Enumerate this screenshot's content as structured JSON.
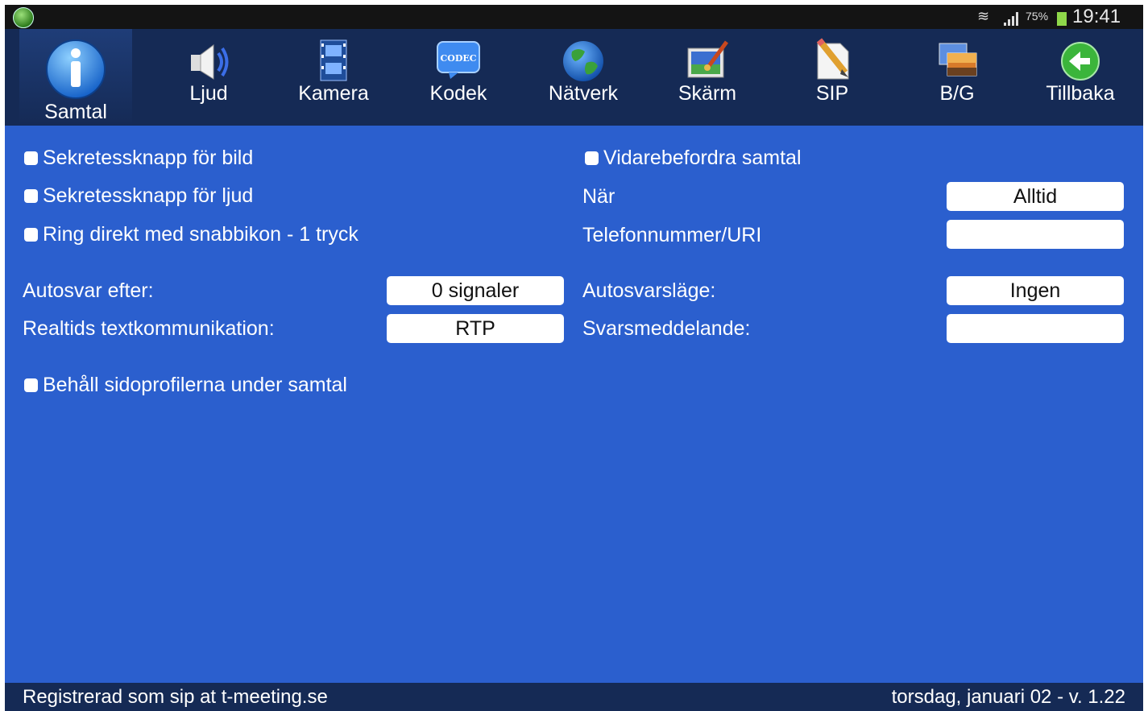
{
  "status": {
    "battery": "75%",
    "time": "19:41"
  },
  "toolbar": [
    {
      "label": "Samtal",
      "icon": "info-icon"
    },
    {
      "label": "Ljud",
      "icon": "speaker-icon"
    },
    {
      "label": "Kamera",
      "icon": "film-icon"
    },
    {
      "label": "Kodek",
      "icon": "codec-icon",
      "icon_text": "CODEC"
    },
    {
      "label": "Nätverk",
      "icon": "globe-icon"
    },
    {
      "label": "Skärm",
      "icon": "screen-brush-icon"
    },
    {
      "label": "SIP",
      "icon": "pencil-document-icon"
    },
    {
      "label": "B/G",
      "icon": "background-picture-icon"
    },
    {
      "label": "Tillbaka",
      "icon": "back-arrow-icon"
    }
  ],
  "left": {
    "cb_bild": "Sekretessknapp för bild",
    "cb_ljud": "Sekretessknapp för ljud",
    "cb_ring": "Ring direkt med snabbikon - 1 tryck",
    "autosvar_label": "Autosvar efter:",
    "autosvar_value": "0 signaler",
    "rtt_label": "Realtids textkommunikation:",
    "rtt_value": "RTP",
    "cb_behall": "Behåll sidoprofilerna under samtal"
  },
  "right": {
    "cb_vidare": "Vidarebefordra samtal",
    "nar_label": "När",
    "nar_value": "Alltid",
    "tel_label": "Telefonnummer/URI",
    "tel_value": "",
    "autolage_label": "Autosvarsläge:",
    "autolage_value": "Ingen",
    "svar_label": "Svarsmeddelande:",
    "svar_value": ""
  },
  "footer": {
    "left": "Registrerad som sip at t-meeting.se",
    "right": "torsdag, januari 02 - v. 1.22"
  }
}
